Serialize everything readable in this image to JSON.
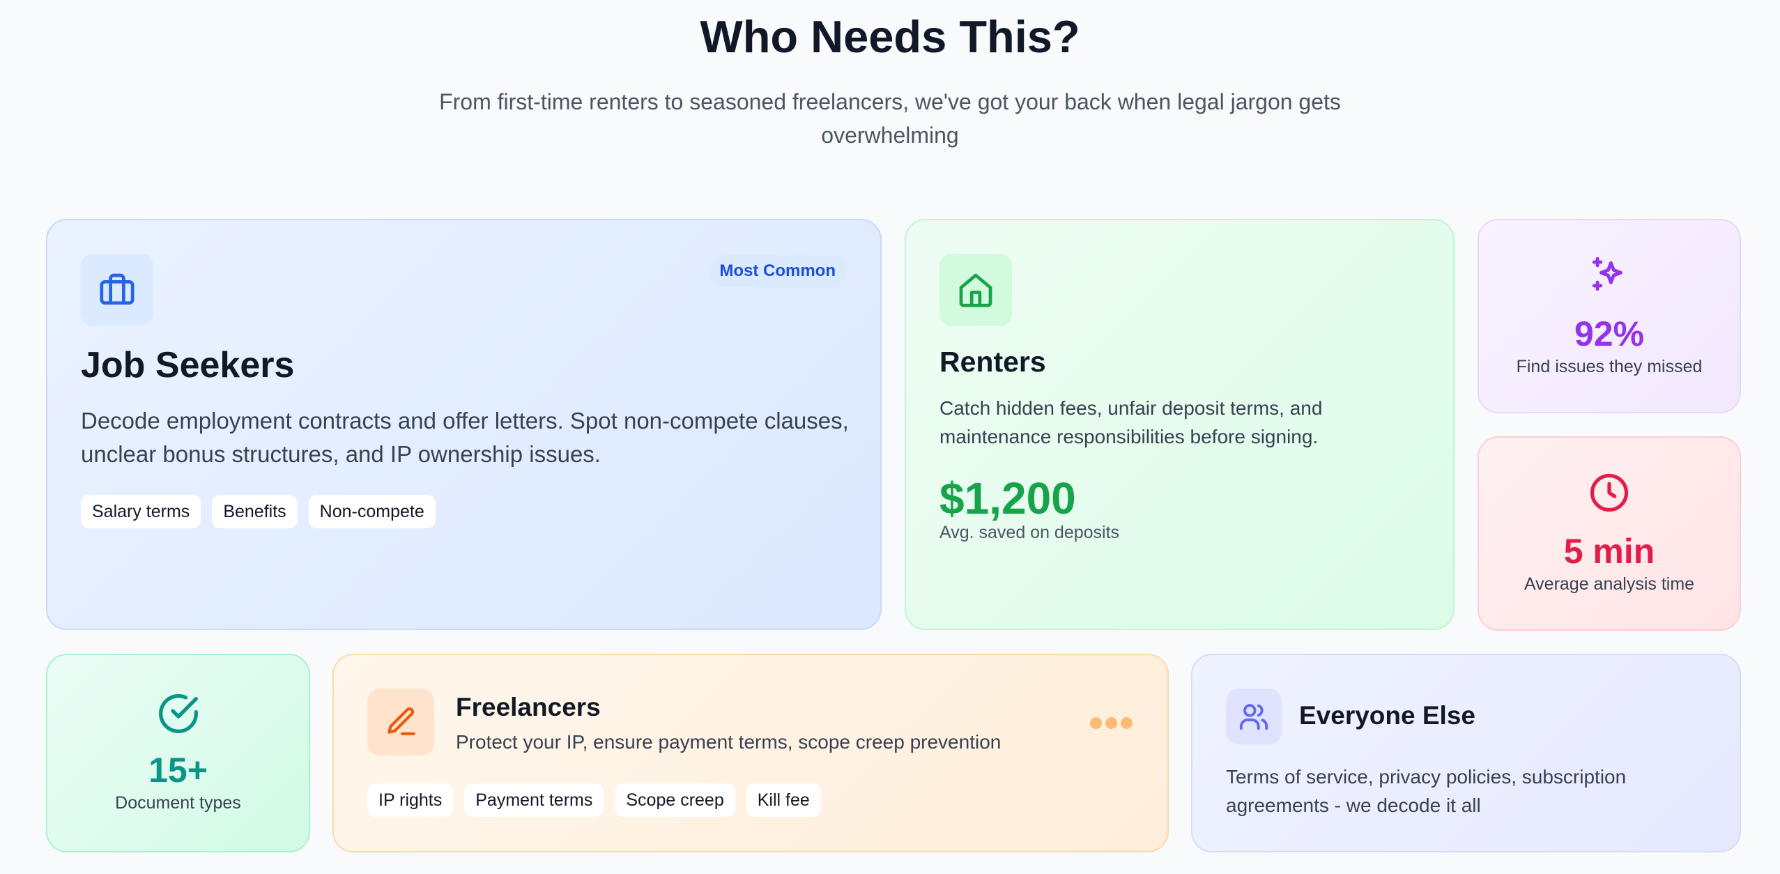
{
  "header": {
    "title": "Who Needs This?",
    "subtitle": "From first-time renters to seasoned freelancers, we've got your back when legal jargon gets overwhelming"
  },
  "cards": {
    "job_seekers": {
      "icon": "briefcase-icon",
      "badge": "Most Common",
      "title": "Job Seekers",
      "description": "Decode employment contracts and offer letters. Spot non-compete clauses, unclear bonus structures, and IP ownership issues.",
      "tags": [
        "Salary terms",
        "Benefits",
        "Non-compete"
      ],
      "accent": "#2563eb"
    },
    "renters": {
      "icon": "home-icon",
      "title": "Renters",
      "description": "Catch hidden fees, unfair deposit terms, and maintenance responsibilities before signing.",
      "stat_value": "$1,200",
      "stat_label": "Avg. saved on deposits",
      "accent": "#16a34a"
    },
    "issues_stat": {
      "icon": "sparkles-icon",
      "value": "92%",
      "label": "Find issues they missed",
      "accent": "#9333ea"
    },
    "time_stat": {
      "icon": "clock-icon",
      "value": "5 min",
      "label": "Average analysis time",
      "accent": "#e11d48"
    },
    "docs_stat": {
      "icon": "check-circle-icon",
      "value": "15+",
      "label": "Document types",
      "accent": "#0d9488"
    },
    "freelancers": {
      "icon": "pen-icon",
      "title": "Freelancers",
      "description": "Protect your IP, ensure payment terms, scope creep prevention",
      "tags": [
        "IP rights",
        "Payment terms",
        "Scope creep",
        "Kill fee"
      ],
      "accent": "#ea580c"
    },
    "everyone_else": {
      "icon": "users-icon",
      "title": "Everyone Else",
      "description": "Terms of service, privacy policies, subscription agreements - we decode it all",
      "accent": "#6366f1"
    }
  }
}
